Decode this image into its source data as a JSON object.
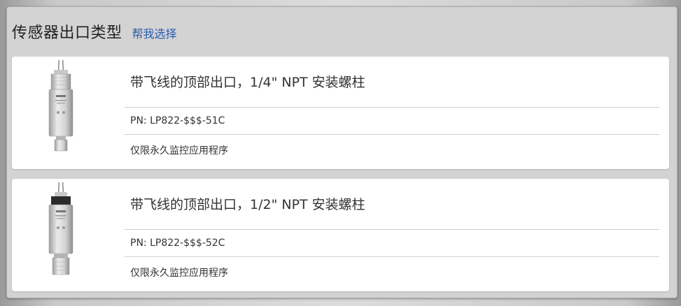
{
  "section": {
    "title": "传感器出口类型",
    "help_link": "帮我选择"
  },
  "products": [
    {
      "title": "带飞线的顶部出口，1/4\" NPT 安装螺柱",
      "pn": "PN: LP822-$$$-51C",
      "note": "仅限永久监控应用程序",
      "image_icon": "sensor-image"
    },
    {
      "title": "带飞线的顶部出口，1/2\" NPT 安装螺柱",
      "pn": "PN: LP822-$$$-52C",
      "note": "仅限永久监控应用程序",
      "image_icon": "sensor-image"
    }
  ]
}
